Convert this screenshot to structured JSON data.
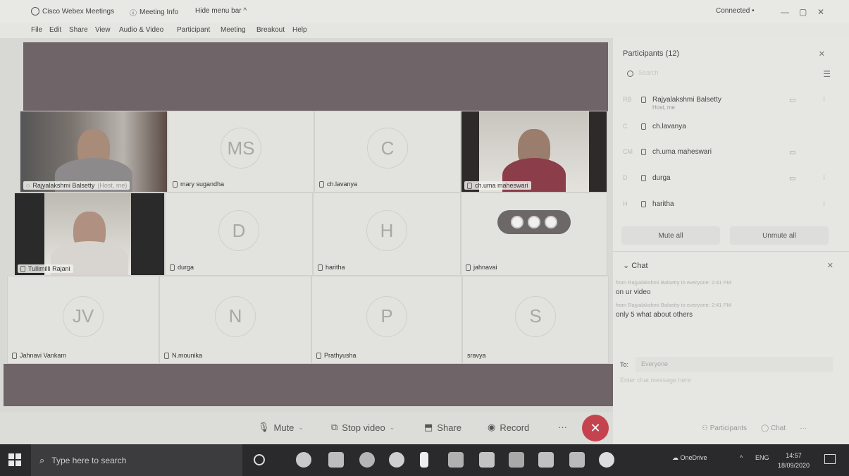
{
  "titlebar": {
    "app_title": "Cisco Webex Meetings",
    "meeting_info": "Meeting Info",
    "hide_menu": "Hide menu bar ^",
    "status": "Connected •",
    "win_min": "—",
    "win_restore": "▢",
    "win_close": "✕"
  },
  "menu": [
    "File",
    "Edit",
    "Share",
    "View",
    "Audio & Video",
    "Participant",
    "Meeting",
    "Breakout",
    "Help"
  ],
  "tiles": [
    {
      "name": "Rajyalakshmi  Balsetty",
      "host_tag": "(Host, me)"
    },
    {
      "initials": "MS",
      "name": "mary sugandha"
    },
    {
      "initials": "C",
      "name": "ch.lavanya"
    },
    {
      "name": "ch.uma maheswari"
    },
    {
      "name": "Tullimilli Rajani"
    },
    {
      "initials": "D",
      "name": "durga"
    },
    {
      "initials": "H",
      "name": "haritha"
    },
    {
      "name": "jahnavai"
    },
    {
      "initials": "JV",
      "name": "Jahnavi Vankam"
    },
    {
      "initials": "N",
      "name": "N.mounika"
    },
    {
      "initials": "P",
      "name": "Prathyusha"
    },
    {
      "initials": "S",
      "name": "sravya"
    }
  ],
  "controls": {
    "mute": "Mute",
    "stop_video": "Stop video",
    "share": "Share",
    "record": "Record",
    "more": "···",
    "end": "✕"
  },
  "participants_panel": {
    "title": "Participants (12)",
    "close": "✕",
    "search_placeholder": "Search",
    "sort_icon": "☰",
    "rows": [
      {
        "initials": "RB",
        "name": "Rajyalakshmi  Balsetty",
        "sub": "Host, me",
        "cam": "▭",
        "more": "⁝"
      },
      {
        "initials": "C",
        "name": "ch.lavanya",
        "sub": "",
        "cam": "",
        "more": ""
      },
      {
        "initials": "CM",
        "name": "ch.uma maheswari",
        "sub": "",
        "cam": "▭",
        "more": ""
      },
      {
        "initials": "D",
        "name": "durga",
        "sub": "",
        "cam": "▭",
        "more": "⁝"
      },
      {
        "initials": "H",
        "name": "haritha",
        "sub": "",
        "cam": "",
        "more": "⁝"
      }
    ],
    "mute_all": "Mute all",
    "unmute_all": "Unmute all"
  },
  "chat_panel": {
    "title": "Chat",
    "close": "✕",
    "messages": [
      {
        "meta": "from Rajyalakshmi Balsetty to everyone:   2:41 PM",
        "text": "on ur video"
      },
      {
        "meta": "from Rajyalakshmi Balsetty to everyone:   2:41 PM",
        "text": "only 5 what about others"
      }
    ],
    "to_label": "To:",
    "to_value": "Everyone",
    "input_placeholder": "Enter chat message here"
  },
  "panel_footer": {
    "participants": "Participants",
    "chat": "Chat",
    "more": "···"
  },
  "taskbar": {
    "search_placeholder": "Type here to search",
    "onedrive": "OneDrive",
    "lang": "ENG",
    "time": "14:57",
    "date": "18/09/2020"
  }
}
